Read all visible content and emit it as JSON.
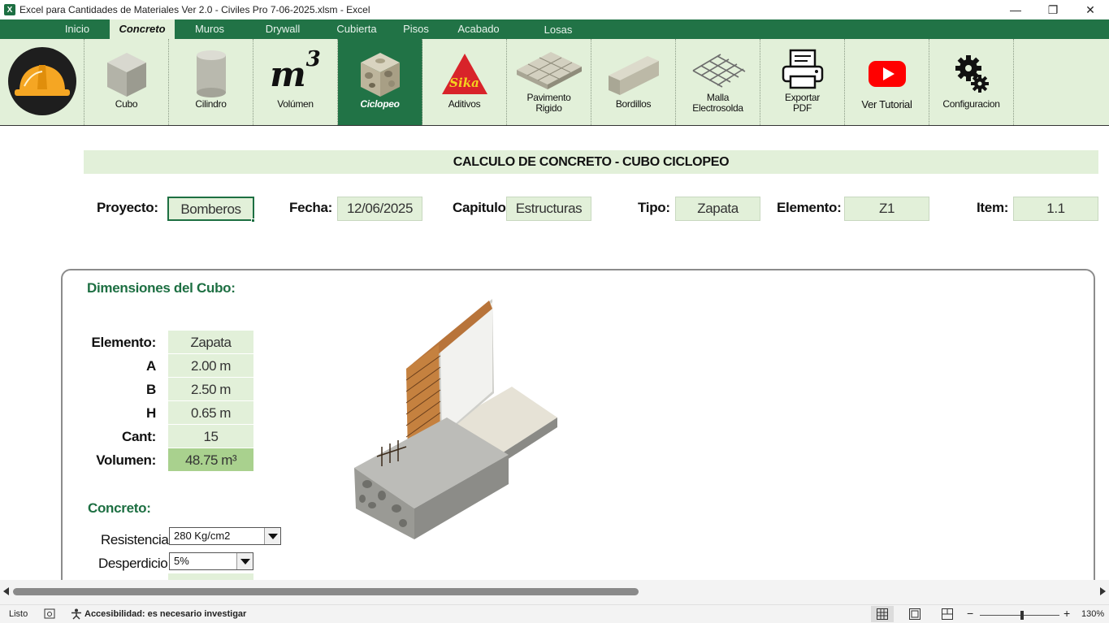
{
  "window": {
    "title": "Excel para Cantidades de Materiales Ver 2.0 - Civiles Pro 7-06-2025.xlsm  -  Excel",
    "app_icon_letter": "X",
    "minimize": "—",
    "restore": "❐",
    "close": "✕"
  },
  "tabs": [
    {
      "label": "Inicio",
      "active": false
    },
    {
      "label": "Concreto",
      "active": true
    },
    {
      "label": "Muros",
      "active": false
    },
    {
      "label": "Drywall",
      "active": false
    },
    {
      "label": "Cubierta",
      "active": false
    },
    {
      "label": "Pisos",
      "active": false
    },
    {
      "label": "Acabado",
      "active": false
    },
    {
      "label": "Losas",
      "active": false
    }
  ],
  "ribbon": {
    "buttons": [
      {
        "label": "Cubo",
        "icon": "cube-icon"
      },
      {
        "label": "Cilindro",
        "icon": "cylinder-icon"
      },
      {
        "label": "Volúmen",
        "icon": "volume-m3-icon",
        "icon_text": "m",
        "icon_sup": "3"
      },
      {
        "label": "Ciclopeo",
        "icon": "cyclopean-block-icon",
        "active": true
      },
      {
        "label": "Aditivos",
        "icon": "sika-logo-icon",
        "icon_text": "Sika"
      },
      {
        "label": "Pavimento\nRigido",
        "icon": "pavement-icon"
      },
      {
        "label": "Bordillos",
        "icon": "curb-icon"
      },
      {
        "label": "Malla\nElectrosolda",
        "icon": "mesh-icon"
      },
      {
        "label": "Exportar\nPDF",
        "icon": "printer-icon"
      },
      {
        "label": "Ver Tutorial",
        "icon": "youtube-icon"
      },
      {
        "label": "Configuracion",
        "icon": "gears-icon"
      }
    ]
  },
  "sheet": {
    "header": "CALCULO DE CONCRETO - CUBO CICLOPEO",
    "fields": {
      "proyecto_label": "Proyecto:",
      "proyecto": "Bomberos",
      "fecha_label": "Fecha:",
      "fecha": "12/06/2025",
      "capitulo_label": "Capitulo",
      "capitulo": "Estructuras",
      "tipo_label": "Tipo:",
      "tipo": "Zapata",
      "elemento_label": "Elemento:",
      "elemento": "Z1",
      "item_label": "Item:",
      "item": "1.1"
    },
    "dimensions": {
      "title": "Dimensiones del Cubo:",
      "rows": [
        {
          "label": "Elemento:",
          "value": "Zapata"
        },
        {
          "label": "A",
          "value": "2.00 m"
        },
        {
          "label": "B",
          "value": "2.50 m"
        },
        {
          "label": "H",
          "value": "0.65 m"
        },
        {
          "label": "Cant:",
          "value": "15"
        },
        {
          "label": "Volumen:",
          "value": "48.75 m³"
        }
      ]
    },
    "concreto": {
      "title": "Concreto:",
      "resistencia_label": "Resistencia",
      "resistencia": "280 Kg/cm2",
      "desperdicio_label": "Desperdicio",
      "desperdicio": "5%"
    }
  },
  "statusbar": {
    "ready": "Listo",
    "accessibility": "Accesibilidad: es necesario investigar",
    "zoom_minus": "−",
    "zoom_plus": "+",
    "zoom": "130%"
  },
  "colors": {
    "accent": "#217346",
    "light_fill": "#e2f0d9",
    "volume_fill": "#a9d18e",
    "section_title": "#1d6f42"
  }
}
